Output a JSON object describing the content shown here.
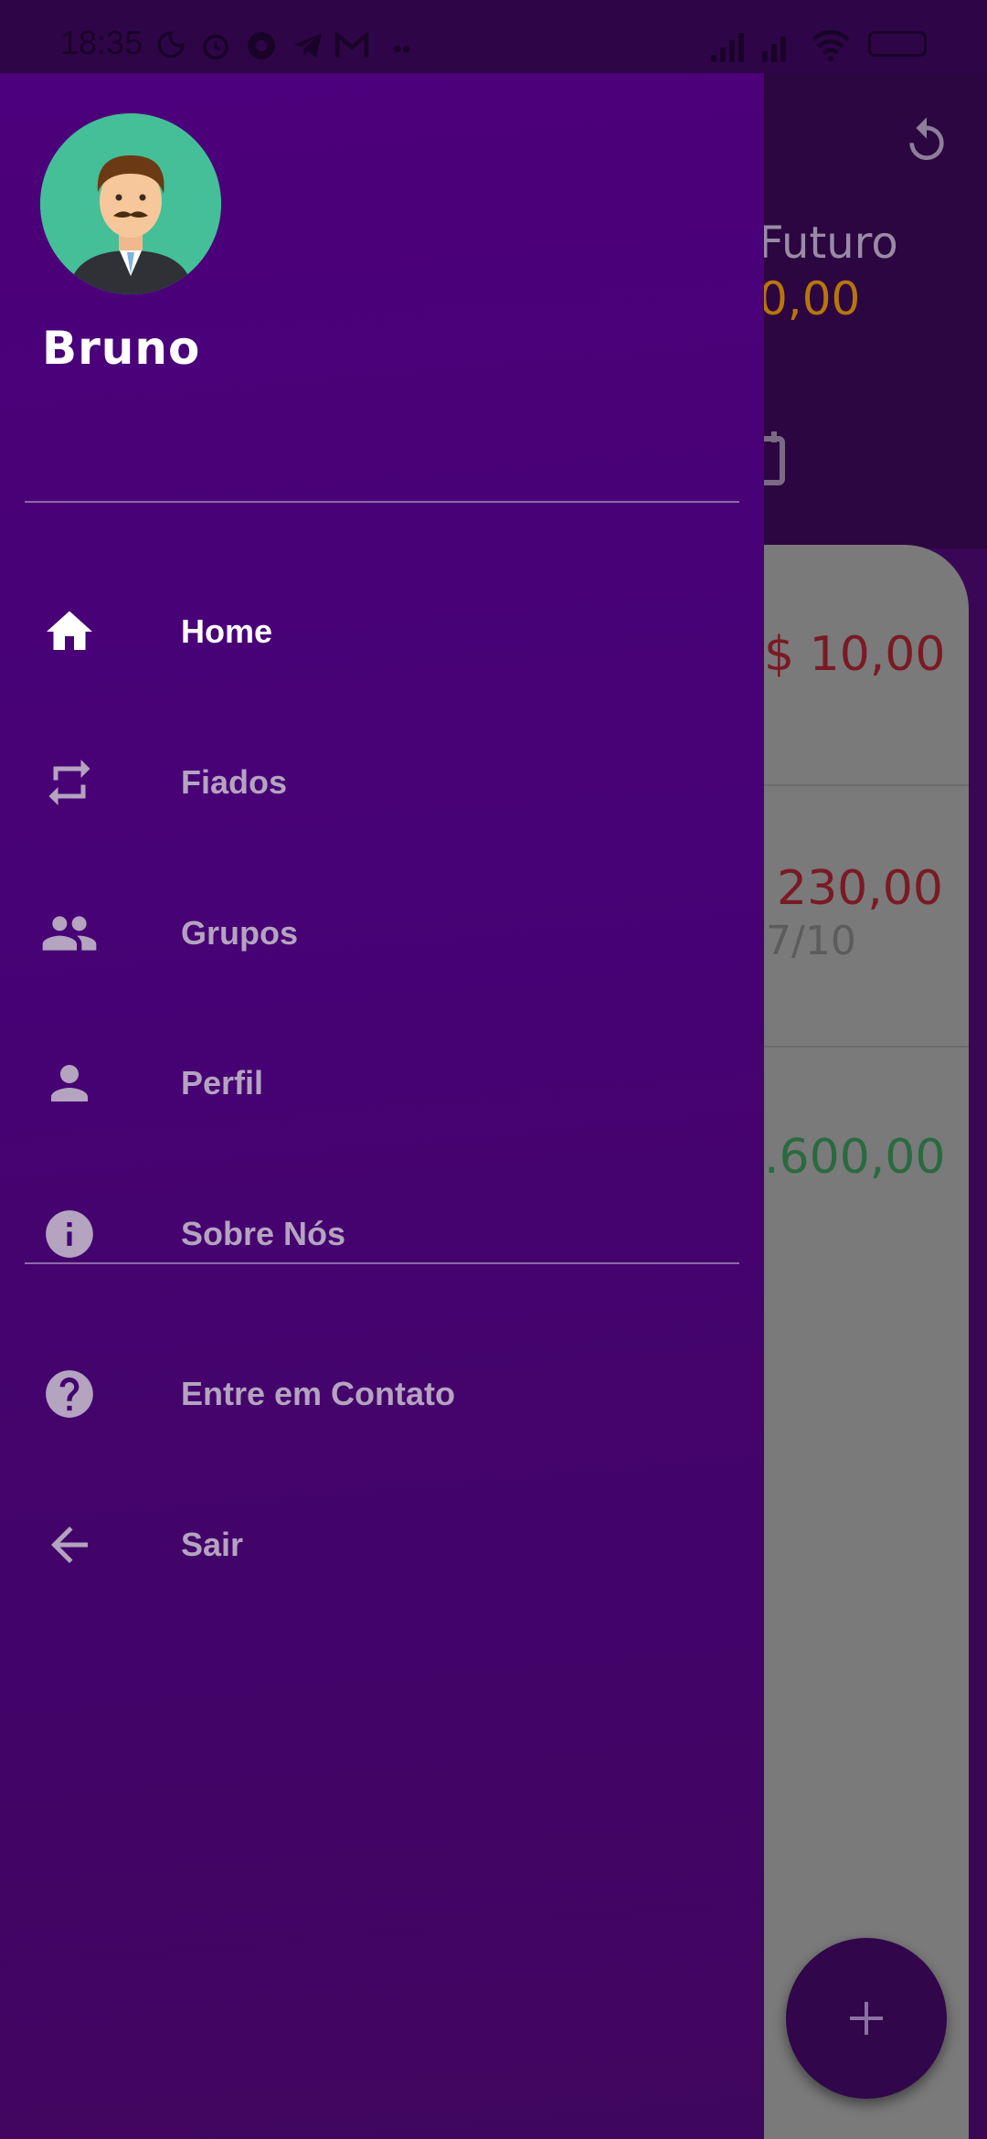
{
  "status_bar": {
    "time": "18:35"
  },
  "drawer": {
    "user_name": "Bruno",
    "menu": [
      {
        "label": "Home",
        "icon": "home-icon",
        "active": true
      },
      {
        "label": "Fiados",
        "icon": "repeat-icon"
      },
      {
        "label": "Grupos",
        "icon": "group-icon"
      },
      {
        "label": "Perfil",
        "icon": "person-icon"
      },
      {
        "label": "Sobre Nós",
        "icon": "info-icon"
      }
    ],
    "secondary_menu": [
      {
        "label": "Entre em Contato",
        "icon": "help-icon"
      },
      {
        "label": "Sair",
        "icon": "arrow-back-icon"
      }
    ]
  },
  "background": {
    "header_label": "Futuro",
    "header_value": "0,00",
    "rows": [
      {
        "amount": "$ 10,00",
        "amount_color": "#7a1a24"
      },
      {
        "amount": "230,00",
        "sub": "7/10",
        "amount_color": "#7a1a24"
      },
      {
        "amount": ".600,00",
        "amount_color": "#2a6a40"
      }
    ],
    "accent_orange": "#b8760a"
  }
}
